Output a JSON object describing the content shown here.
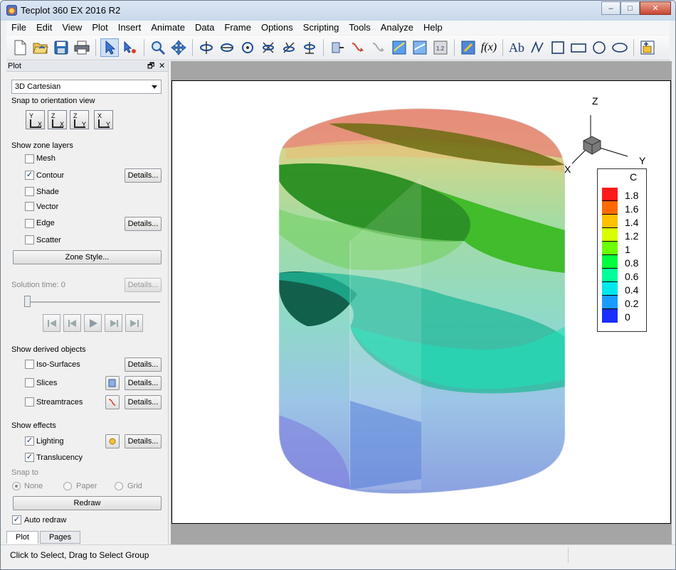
{
  "window": {
    "title": "Tecplot 360 EX 2016 R2",
    "minimize": "‒",
    "maximize": "□",
    "close": "✕"
  },
  "menu": [
    "File",
    "Edit",
    "View",
    "Plot",
    "Insert",
    "Animate",
    "Data",
    "Frame",
    "Options",
    "Scripting",
    "Tools",
    "Analyze",
    "Help"
  ],
  "toolbar": {
    "icons": [
      "new-file-icon",
      "open-folder-icon",
      "save-icon",
      "print-icon",
      "select-arrow-icon",
      "adjustor-icon",
      "zoom-icon",
      "translate-icon",
      "rotate-x-icon",
      "rotate-y-icon",
      "rotate-z-icon",
      "roll-icon",
      "spin-icon",
      "twist-icon",
      "probe-icon",
      "streamtrace-icon",
      "slice-icon",
      "contour-level-add-icon",
      "contour-level-remove-icon",
      "image-icon",
      "color-map-icon",
      "function-icon",
      "text-icon",
      "polyline-icon",
      "square-icon",
      "rectangle-icon",
      "circle-icon",
      "ellipse-icon",
      "add-frame-icon"
    ],
    "function_label": "f(x)",
    "text_label": "Ab"
  },
  "panel": {
    "title": "Plot",
    "float_btn": "🗗",
    "close_btn": "✕",
    "plot_type": "3D Cartesian",
    "snap_label": "Snap to orientation view",
    "snap_buttons": [
      {
        "a": "Y",
        "b": "X"
      },
      {
        "a": "Z",
        "b": "X"
      },
      {
        "a": "Z",
        "b": "Y"
      },
      {
        "a": "X",
        "b": "Y"
      }
    ],
    "zone_layers_label": "Show zone layers",
    "layers": [
      {
        "label": "Mesh",
        "checked": false
      },
      {
        "label": "Contour",
        "checked": true,
        "details": "Details..."
      },
      {
        "label": "Shade",
        "checked": false
      },
      {
        "label": "Vector",
        "checked": false
      },
      {
        "label": "Edge",
        "checked": false,
        "details": "Details..."
      },
      {
        "label": "Scatter",
        "checked": false
      }
    ],
    "zone_style": "Zone Style...",
    "solution_time": "Solution time: 0",
    "solution_details": "Details...",
    "derived_label": "Show derived objects",
    "derived": [
      {
        "label": "Iso-Surfaces",
        "details": "Details..."
      },
      {
        "label": "Slices",
        "details": "Details..."
      },
      {
        "label": "Streamtraces",
        "details": "Details..."
      }
    ],
    "effects_label": "Show effects",
    "effects": [
      {
        "label": "Lighting",
        "checked": true,
        "details": "Details..."
      },
      {
        "label": "Translucency",
        "checked": true
      }
    ],
    "snap_to_label": "Snap to",
    "snap_options": [
      "None",
      "Paper",
      "Grid"
    ],
    "redraw": "Redraw",
    "auto_redraw": "Auto redraw",
    "tabs": [
      "Plot",
      "Pages"
    ]
  },
  "plot": {
    "axis_labels": {
      "z": "Z",
      "x": "X",
      "y": "Y"
    },
    "legend_title": "C",
    "legend_levels": [
      "1.8",
      "1.6",
      "1.4",
      "1.2",
      "1",
      "0.8",
      "0.6",
      "0.4",
      "0.2",
      "0"
    ],
    "legend_colors": [
      "#ff0000",
      "#ff6a00",
      "#ffc000",
      "#d8ff00",
      "#6cff00",
      "#00ff18",
      "#00ff86",
      "#00f0e8",
      "#00a8ff",
      "#2040ff",
      "#0018e0"
    ]
  },
  "status": {
    "text": "Click to Select, Drag to Select Group"
  }
}
